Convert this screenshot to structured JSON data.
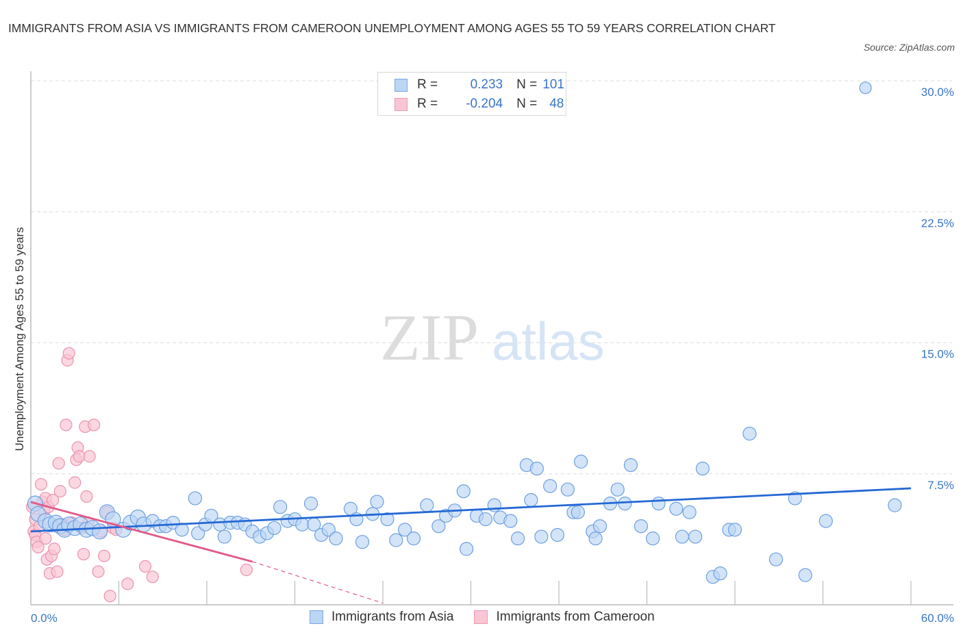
{
  "title": "IMMIGRANTS FROM ASIA VS IMMIGRANTS FROM CAMEROON UNEMPLOYMENT AMONG AGES 55 TO 59 YEARS CORRELATION CHART",
  "source": "Source: ZipAtlas.com",
  "watermark": {
    "zip": "ZIP",
    "atlas": "atlas"
  },
  "legend": {
    "rows": [
      {
        "r_label": "R =",
        "r_value": "0.233",
        "n_label": "N =",
        "n_value": "101"
      },
      {
        "r_label": "R =",
        "r_value": "-0.204",
        "n_label": "N =",
        "n_value": "48"
      }
    ]
  },
  "bottom_legend": [
    "Immigrants from Asia",
    "Immigrants from Cameroon"
  ],
  "colors": {
    "asia_fill": "#bcd5f5",
    "asia_stroke": "#6d9fe0",
    "asia_line": "#2468d4",
    "cameroon_fill": "#f8c6d4",
    "cameroon_stroke": "#ec92ae",
    "cameroon_line": "#e05a88",
    "tick_text": "#3a74c8"
  },
  "chart_data": {
    "type": "scatter",
    "title": "IMMIGRANTS FROM ASIA VS IMMIGRANTS FROM CAMEROON UNEMPLOYMENT AMONG AGES 55 TO 59 YEARS CORRELATION CHART",
    "xlabel": "",
    "ylabel": "Unemployment Among Ages 55 to 59 years",
    "xlim": [
      0,
      60
    ],
    "ylim": [
      0,
      30
    ],
    "x_tick_labels": [
      "0.0%",
      "60.0%"
    ],
    "y_ticks": [
      7.5,
      15.0,
      22.5,
      30.0
    ],
    "y_tick_labels": [
      "7.5%",
      "15.0%",
      "22.5%",
      "30.0%"
    ],
    "grid": "horizontal dashed",
    "legend_position": "top-center",
    "series": [
      {
        "name": "Immigrants from Asia",
        "R": 0.233,
        "N": 101,
        "trend": {
          "x": [
            0,
            60
          ],
          "y": [
            4.2,
            6.67
          ]
        },
        "points": [
          [
            0.3,
            5.8
          ],
          [
            0.5,
            5.2
          ],
          [
            1.0,
            4.8
          ],
          [
            1.3,
            4.6
          ],
          [
            1.7,
            4.7
          ],
          [
            2.0,
            4.5
          ],
          [
            2.3,
            4.3
          ],
          [
            2.6,
            4.6
          ],
          [
            3.0,
            4.4
          ],
          [
            3.4,
            4.6
          ],
          [
            3.8,
            4.3
          ],
          [
            4.2,
            4.4
          ],
          [
            4.7,
            4.2
          ],
          [
            5.2,
            5.3
          ],
          [
            5.6,
            4.9
          ],
          [
            6.3,
            4.3
          ],
          [
            6.8,
            4.7
          ],
          [
            7.3,
            5.0
          ],
          [
            7.7,
            4.6
          ],
          [
            8.3,
            4.8
          ],
          [
            8.8,
            4.5
          ],
          [
            9.2,
            4.5
          ],
          [
            9.7,
            4.7
          ],
          [
            10.3,
            4.3
          ],
          [
            11.2,
            6.1
          ],
          [
            11.4,
            4.1
          ],
          [
            11.9,
            4.6
          ],
          [
            12.3,
            5.1
          ],
          [
            12.9,
            4.6
          ],
          [
            13.2,
            3.9
          ],
          [
            13.6,
            4.7
          ],
          [
            14.1,
            4.7
          ],
          [
            14.6,
            4.6
          ],
          [
            15.1,
            4.2
          ],
          [
            15.6,
            3.9
          ],
          [
            16.1,
            4.1
          ],
          [
            16.6,
            4.4
          ],
          [
            17.0,
            5.6
          ],
          [
            17.5,
            4.8
          ],
          [
            18.0,
            4.9
          ],
          [
            18.5,
            4.6
          ],
          [
            19.1,
            5.8
          ],
          [
            19.3,
            4.6
          ],
          [
            19.8,
            4.0
          ],
          [
            20.3,
            4.3
          ],
          [
            20.8,
            3.8
          ],
          [
            21.8,
            5.5
          ],
          [
            22.2,
            4.9
          ],
          [
            22.6,
            3.6
          ],
          [
            23.3,
            5.2
          ],
          [
            23.6,
            5.9
          ],
          [
            24.3,
            4.9
          ],
          [
            24.9,
            3.7
          ],
          [
            25.5,
            4.3
          ],
          [
            26.1,
            3.8
          ],
          [
            27.0,
            5.7
          ],
          [
            27.8,
            4.5
          ],
          [
            28.3,
            5.1
          ],
          [
            28.9,
            5.4
          ],
          [
            29.5,
            6.5
          ],
          [
            29.7,
            3.2
          ],
          [
            30.4,
            5.1
          ],
          [
            31.0,
            4.9
          ],
          [
            31.6,
            5.7
          ],
          [
            32.0,
            5.0
          ],
          [
            32.7,
            4.8
          ],
          [
            33.2,
            3.8
          ],
          [
            33.8,
            8.0
          ],
          [
            34.1,
            6.0
          ],
          [
            34.5,
            7.8
          ],
          [
            34.8,
            3.9
          ],
          [
            35.4,
            6.8
          ],
          [
            35.9,
            4.0
          ],
          [
            36.6,
            6.6
          ],
          [
            37.0,
            5.3
          ],
          [
            37.3,
            5.3
          ],
          [
            37.5,
            8.2
          ],
          [
            38.3,
            4.2
          ],
          [
            38.5,
            3.8
          ],
          [
            38.8,
            4.5
          ],
          [
            39.5,
            5.8
          ],
          [
            40.0,
            6.6
          ],
          [
            40.5,
            5.8
          ],
          [
            40.9,
            8.0
          ],
          [
            41.6,
            4.5
          ],
          [
            42.4,
            3.8
          ],
          [
            42.8,
            5.8
          ],
          [
            44.0,
            5.5
          ],
          [
            44.4,
            3.9
          ],
          [
            44.9,
            5.3
          ],
          [
            45.3,
            3.9
          ],
          [
            45.8,
            7.8
          ],
          [
            46.5,
            1.6
          ],
          [
            47.0,
            1.8
          ],
          [
            47.6,
            4.3
          ],
          [
            48.0,
            4.3
          ],
          [
            49.0,
            9.8
          ],
          [
            50.8,
            2.6
          ],
          [
            52.1,
            6.1
          ],
          [
            52.8,
            1.7
          ],
          [
            54.2,
            4.8
          ],
          [
            56.9,
            29.6
          ],
          [
            58.9,
            5.7
          ]
        ]
      },
      {
        "name": "Immigrants from Cameroon",
        "R": -0.204,
        "N": 48,
        "trend": {
          "x": [
            0,
            15.1
          ],
          "y": [
            5.88,
            2.47
          ],
          "dashed_extension": {
            "x": [
              15.1,
              24.0
            ],
            "y": [
              2.47,
              0.1
            ]
          }
        },
        "points": [
          [
            0.1,
            5.6
          ],
          [
            0.2,
            4.2
          ],
          [
            0.3,
            4.9
          ],
          [
            0.3,
            4.0
          ],
          [
            0.4,
            3.6
          ],
          [
            0.5,
            3.3
          ],
          [
            0.6,
            4.5
          ],
          [
            0.7,
            6.9
          ],
          [
            0.8,
            5.9
          ],
          [
            0.9,
            5.4
          ],
          [
            1.0,
            3.8
          ],
          [
            1.0,
            6.1
          ],
          [
            1.1,
            2.6
          ],
          [
            1.2,
            5.6
          ],
          [
            1.3,
            1.8
          ],
          [
            1.4,
            2.8
          ],
          [
            1.5,
            6.0
          ],
          [
            1.6,
            3.2
          ],
          [
            1.7,
            4.5
          ],
          [
            1.8,
            1.9
          ],
          [
            1.9,
            8.1
          ],
          [
            2.0,
            6.5
          ],
          [
            2.2,
            4.6
          ],
          [
            2.3,
            4.3
          ],
          [
            2.4,
            10.3
          ],
          [
            2.5,
            14.0
          ],
          [
            2.6,
            14.4
          ],
          [
            2.8,
            4.7
          ],
          [
            3.0,
            7.0
          ],
          [
            3.1,
            8.3
          ],
          [
            3.2,
            9.0
          ],
          [
            3.3,
            8.5
          ],
          [
            3.5,
            4.4
          ],
          [
            3.6,
            2.9
          ],
          [
            3.7,
            10.2
          ],
          [
            3.8,
            6.2
          ],
          [
            3.9,
            4.7
          ],
          [
            4.0,
            8.5
          ],
          [
            4.3,
            10.3
          ],
          [
            4.6,
            1.9
          ],
          [
            4.8,
            4.2
          ],
          [
            5.0,
            2.8
          ],
          [
            5.2,
            5.3
          ],
          [
            5.4,
            0.5
          ],
          [
            5.6,
            4.4
          ],
          [
            5.8,
            4.3
          ],
          [
            6.6,
            1.2
          ],
          [
            7.8,
            2.2
          ],
          [
            8.3,
            1.6
          ],
          [
            14.7,
            2.0
          ]
        ]
      }
    ]
  }
}
